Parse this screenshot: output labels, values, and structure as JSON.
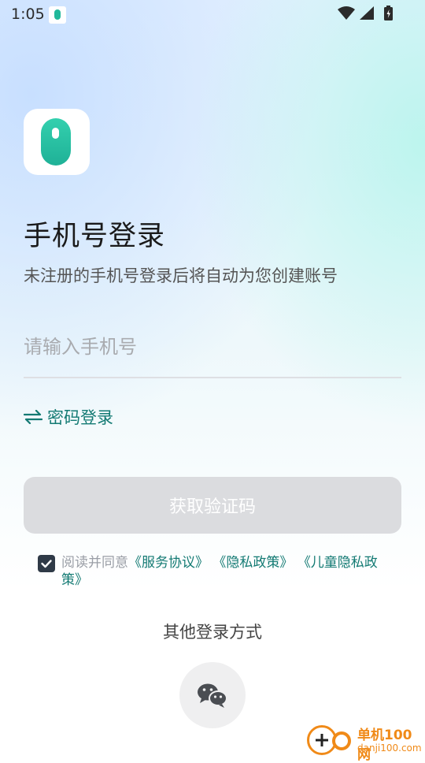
{
  "status_bar": {
    "time": "1:05"
  },
  "app_logo": {
    "accent": "#21b89a"
  },
  "title": "手机号登录",
  "subtitle": "未注册的手机号登录后将自动为您创建账号",
  "phone_input": {
    "placeholder": "请输入手机号",
    "value": ""
  },
  "password_login_label": "密码登录",
  "get_code_label": "获取验证码",
  "agreement": {
    "checked": true,
    "prefix": "阅读并同意",
    "service_link": "《服务协议》",
    "privacy_link": "《隐私政策》",
    "children_link": "《儿童隐私政策》"
  },
  "other_login": {
    "label": "其他登录方式",
    "wechat_icon": "wechat-icon"
  },
  "watermark": {
    "title": "单机100网",
    "url": "danji100.com"
  },
  "colors": {
    "link": "#137a73",
    "button_disabled": "#dbdcdf",
    "watermark": "#f08a18"
  }
}
